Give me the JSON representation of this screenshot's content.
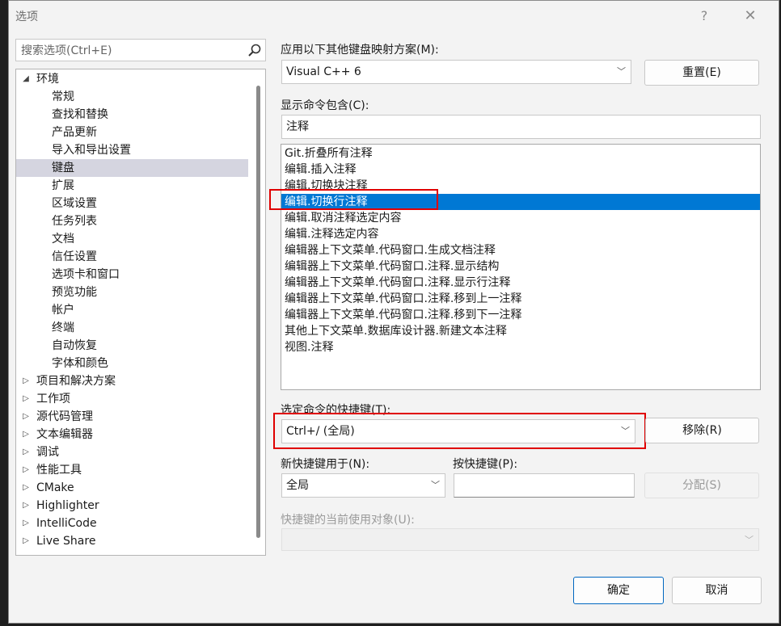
{
  "dialog": {
    "title": "选项",
    "help": "?",
    "close": "✕"
  },
  "search": {
    "placeholder": "搜索选项(Ctrl+E)"
  },
  "tree": {
    "items": [
      {
        "label": "环境",
        "level": 0,
        "arrow": "◢"
      },
      {
        "label": "常规",
        "level": 1
      },
      {
        "label": "查找和替换",
        "level": 1
      },
      {
        "label": "产品更新",
        "level": 1
      },
      {
        "label": "导入和导出设置",
        "level": 1
      },
      {
        "label": "键盘",
        "level": 1,
        "selected": true
      },
      {
        "label": "扩展",
        "level": 1
      },
      {
        "label": "区域设置",
        "level": 1
      },
      {
        "label": "任务列表",
        "level": 1
      },
      {
        "label": "文档",
        "level": 1
      },
      {
        "label": "信任设置",
        "level": 1
      },
      {
        "label": "选项卡和窗口",
        "level": 1
      },
      {
        "label": "预览功能",
        "level": 1
      },
      {
        "label": "帐户",
        "level": 1
      },
      {
        "label": "终端",
        "level": 1
      },
      {
        "label": "自动恢复",
        "level": 1
      },
      {
        "label": "字体和颜色",
        "level": 1
      },
      {
        "label": "项目和解决方案",
        "level": 0,
        "arrow": "▷"
      },
      {
        "label": "工作项",
        "level": 0,
        "arrow": "▷"
      },
      {
        "label": "源代码管理",
        "level": 0,
        "arrow": "▷"
      },
      {
        "label": "文本编辑器",
        "level": 0,
        "arrow": "▷"
      },
      {
        "label": "调试",
        "level": 0,
        "arrow": "▷"
      },
      {
        "label": "性能工具",
        "level": 0,
        "arrow": "▷"
      },
      {
        "label": "CMake",
        "level": 0,
        "arrow": "▷"
      },
      {
        "label": "Highlighter",
        "level": 0,
        "arrow": "▷"
      },
      {
        "label": "IntelliCode",
        "level": 0,
        "arrow": "▷"
      },
      {
        "label": "Live Share",
        "level": 0,
        "arrow": "▷"
      }
    ]
  },
  "mapping": {
    "label": "应用以下其他键盘映射方案(M):",
    "value": "Visual C++ 6",
    "reset_button": "重置(E)"
  },
  "show_commands": {
    "label": "显示命令包含(C):",
    "value": "注释"
  },
  "commands": {
    "items": [
      "Git.折叠所有注释",
      "编辑.插入注释",
      "编辑.切换块注释",
      "编辑.切换行注释",
      "编辑.取消注释选定内容",
      "编辑.注释选定内容",
      "编辑器上下文菜单.代码窗口.生成文档注释",
      "编辑器上下文菜单.代码窗口.注释.显示结构",
      "编辑器上下文菜单.代码窗口.注释.显示行注释",
      "编辑器上下文菜单.代码窗口.注释.移到上一注释",
      "编辑器上下文菜单.代码窗口.注释.移到下一注释",
      "其他上下文菜单.数据库设计器.新建文本注释",
      "视图.注释"
    ],
    "selected_index": 3
  },
  "shortcuts": {
    "label": "选定命令的快捷键(T):",
    "value": "Ctrl+/ (全局)",
    "remove_button": "移除(R)"
  },
  "new_shortcut": {
    "label": "新快捷键用于(N):",
    "value": "全局"
  },
  "press_keys": {
    "label": "按快捷键(P):",
    "value": ""
  },
  "assign_button": "分配(S)",
  "usage": {
    "label": "快捷键的当前使用对象(U):",
    "value": ""
  },
  "footer": {
    "ok": "确定",
    "cancel": "取消"
  },
  "colors": {
    "selection": "#0078d4",
    "highlight_box": "#e00000",
    "tree_selection": "#d5d5e0"
  }
}
